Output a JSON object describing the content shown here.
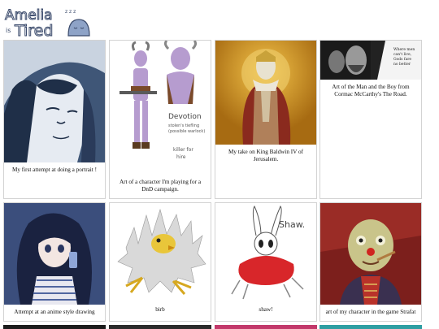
{
  "site": {
    "logo_text_main": "Amelia",
    "logo_text_is": "is",
    "logo_text_tired": "Tired",
    "logo_zzz": "z z z"
  },
  "cards": [
    {
      "caption": "My first attempt at doing a portrait !"
    },
    {
      "caption": "Art of a character I'm playing for a DnD campaign.",
      "note_title": "Devotion",
      "note_lines": [
        "stolen's tiefling",
        "(possible warlock)",
        "killer for",
        "hire"
      ]
    },
    {
      "caption": "My take on King Baldwin IV of Jerusalem."
    },
    {
      "caption": "Art of the Man and the Boy from Cormac McCarthy's The Road.",
      "quote_lines": [
        "Where men",
        "can't live,",
        "Gods fare",
        "no better"
      ]
    },
    {
      "caption": "Attempt at an anime style drawing"
    },
    {
      "caption": "birb"
    },
    {
      "caption": "shaw!",
      "signature": "Shaw."
    },
    {
      "caption": "art of my character in the game Strafat"
    }
  ],
  "colors": {
    "border": "#d3d3d3",
    "logo_ink": "#3a4a6b",
    "logo_blob": "#8ea3c7"
  }
}
